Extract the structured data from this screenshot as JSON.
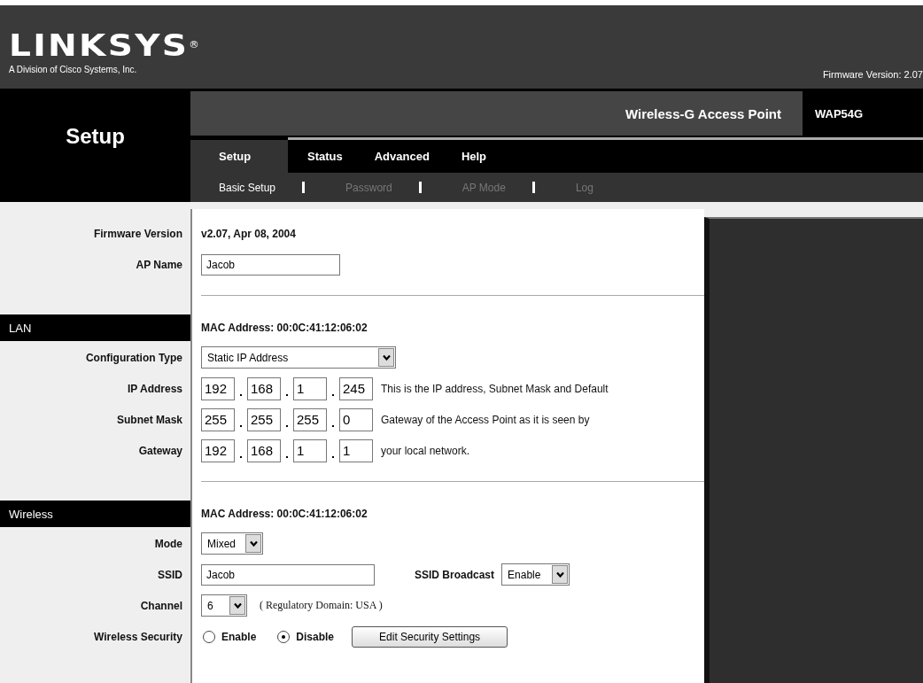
{
  "header": {
    "logo": "LINKSYS",
    "logo_mark": "®",
    "division": "A Division of Cisco Systems, Inc.",
    "firmware": "Firmware Version: 2.07"
  },
  "nav": {
    "section": "Setup",
    "product_name": "Wireless-G Access Point",
    "model": "WAP54G",
    "tabs": [
      {
        "label": "Setup",
        "selected": true
      },
      {
        "label": "Status",
        "selected": false
      },
      {
        "label": "Advanced",
        "selected": false
      },
      {
        "label": "Help",
        "selected": false
      }
    ],
    "subtabs": [
      {
        "label": "Basic Setup",
        "selected": true
      },
      {
        "label": "Password",
        "selected": false
      },
      {
        "label": "AP Mode",
        "selected": false
      },
      {
        "label": "Log",
        "selected": false
      }
    ]
  },
  "sections": [
    {
      "rows": [
        {
          "kind": "text",
          "label": "Firmware Version",
          "value": "v2.07, Apr 08, 2004"
        },
        {
          "kind": "input",
          "label": "AP Name",
          "value": "Jacob"
        }
      ]
    },
    {
      "title": "LAN",
      "heading": "MAC Address: 00:0C:41:12:06:02",
      "rows": [
        {
          "kind": "select",
          "label": "Configuration Type",
          "value": "Static IP Address"
        },
        {
          "kind": "ip",
          "label": "IP Address",
          "octets": [
            "192",
            "168",
            "1",
            "245"
          ],
          "note": "This is the IP address, Subnet Mask and Default"
        },
        {
          "kind": "ip",
          "label": "Subnet Mask",
          "octets": [
            "255",
            "255",
            "255",
            "0"
          ],
          "note": "Gateway of the Access Point as it is seen by"
        },
        {
          "kind": "ip",
          "label": "Gateway",
          "octets": [
            "192",
            "168",
            "1",
            "1"
          ],
          "note": "your local network."
        }
      ]
    },
    {
      "title": "Wireless",
      "heading": "MAC Address: 00:0C:41:12:06:02",
      "rows": [
        {
          "kind": "select",
          "label": "Mode",
          "value": "Mixed"
        },
        {
          "kind": "input",
          "label": "SSID",
          "value": "Jacob",
          "extra_label": "SSID Broadcast",
          "extra_value": "Enable"
        },
        {
          "kind": "select",
          "label": "Channel",
          "value": "6",
          "note": "( Regulatory Domain: USA )"
        },
        {
          "kind": "radios",
          "label": "Wireless Security",
          "options": [
            {
              "label": "Enable",
              "selected": false
            },
            {
              "label": "Disable",
              "selected": true
            }
          ],
          "button": "Edit Security Settings"
        }
      ]
    }
  ]
}
